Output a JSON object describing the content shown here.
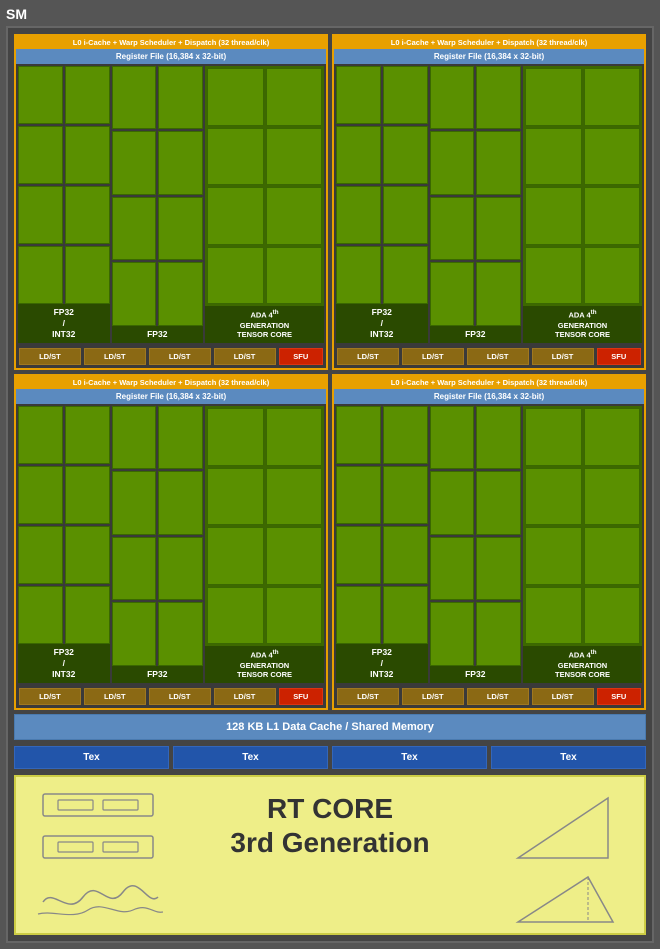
{
  "sm_label": "SM",
  "quadrants": [
    {
      "header": "L0 i-Cache + Warp Scheduler + Dispatch (32 thread/clk)",
      "reg_file": "Register File (16,384 x 32-bit)",
      "fp32int32_label": "FP32\n/\nINT32",
      "fp32_label": "FP32",
      "tensor_label": "ADA 4th GENERATION TENSOR CORE",
      "ldst_labels": [
        "LD/ST",
        "LD/ST",
        "LD/ST",
        "LD/ST"
      ],
      "sfu_label": "SFU"
    },
    {
      "header": "L0 i-Cache + Warp Scheduler + Dispatch (32 thread/clk)",
      "reg_file": "Register File (16,384 x 32-bit)",
      "fp32int32_label": "FP32\n/\nINT32",
      "fp32_label": "FP32",
      "tensor_label": "ADA 4th GENERATION TENSOR CORE",
      "ldst_labels": [
        "LD/ST",
        "LD/ST",
        "LD/ST",
        "LD/ST"
      ],
      "sfu_label": "SFU"
    },
    {
      "header": "L0 i-Cache + Warp Scheduler + Dispatch (32 thread/clk)",
      "reg_file": "Register File (16,384 x 32-bit)",
      "fp32int32_label": "FP32\n/\nINT32",
      "fp32_label": "FP32",
      "tensor_label": "ADA 4th GENERATION TENSOR CORE",
      "ldst_labels": [
        "LD/ST",
        "LD/ST",
        "LD/ST",
        "LD/ST"
      ],
      "sfu_label": "SFU"
    },
    {
      "header": "L0 i-Cache + Warp Scheduler + Dispatch (32 thread/clk)",
      "reg_file": "Register File (16,384 x 32-bit)",
      "fp32int32_label": "FP32\n/\nINT32",
      "fp32_label": "FP32",
      "tensor_label": "ADA 4th GENERATION TENSOR CORE",
      "ldst_labels": [
        "LD/ST",
        "LD/ST",
        "LD/ST",
        "LD/ST"
      ],
      "sfu_label": "SFU"
    }
  ],
  "l1_cache_label": "128 KB L1 Data Cache / Shared Memory",
  "tex_labels": [
    "Tex",
    "Tex",
    "Tex",
    "Tex"
  ],
  "rt_core_title": "RT CORE",
  "rt_core_subtitle": "3rd Generation"
}
